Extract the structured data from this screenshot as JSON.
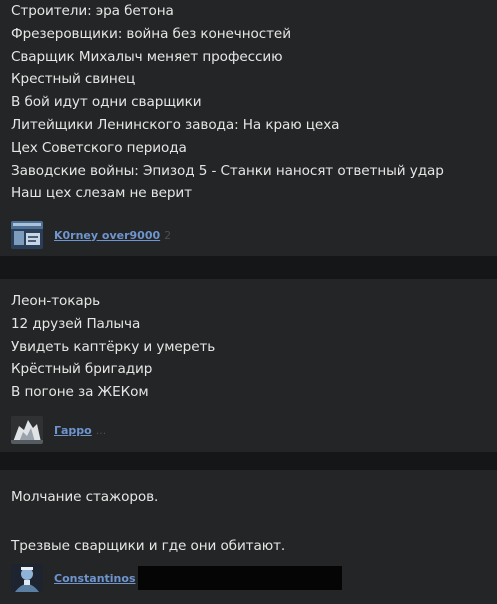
{
  "posts": [
    {
      "lines": [
        "Строители: эра бетона",
        "Фрезеровщики: война без конечностей",
        "Сварщик Михалыч меняет профессию",
        "Крестный свинец",
        "В бой идут одни сварщики",
        "Литейщики Ленинского завода: На краю цеха",
        "Цех Советского периода",
        "Заводские войны: Эпизод 5 - Станки наносят ответный удар",
        "Наш цех слезам не верит"
      ],
      "author": {
        "name": "K0rney over9000",
        "faded": "2"
      }
    },
    {
      "lines": [
        "Леон-токарь",
        "12 друзей Палыча",
        "Увидеть каптёрку и умереть",
        "Крёстный бригадир",
        "В погоне за ЖЕКом"
      ],
      "author": {
        "name": "Гарро",
        "faded": "..."
      }
    },
    {
      "lines": [
        "Молчание стажоров.",
        "",
        "Трезвые сварщики и где они обитают."
      ],
      "author": {
        "name": "Constantinos",
        "faded": ""
      }
    }
  ],
  "colors": {
    "background": "#151617",
    "post_background": "#242526",
    "text": "#e6e6e6",
    "username": "#6f95cf"
  }
}
